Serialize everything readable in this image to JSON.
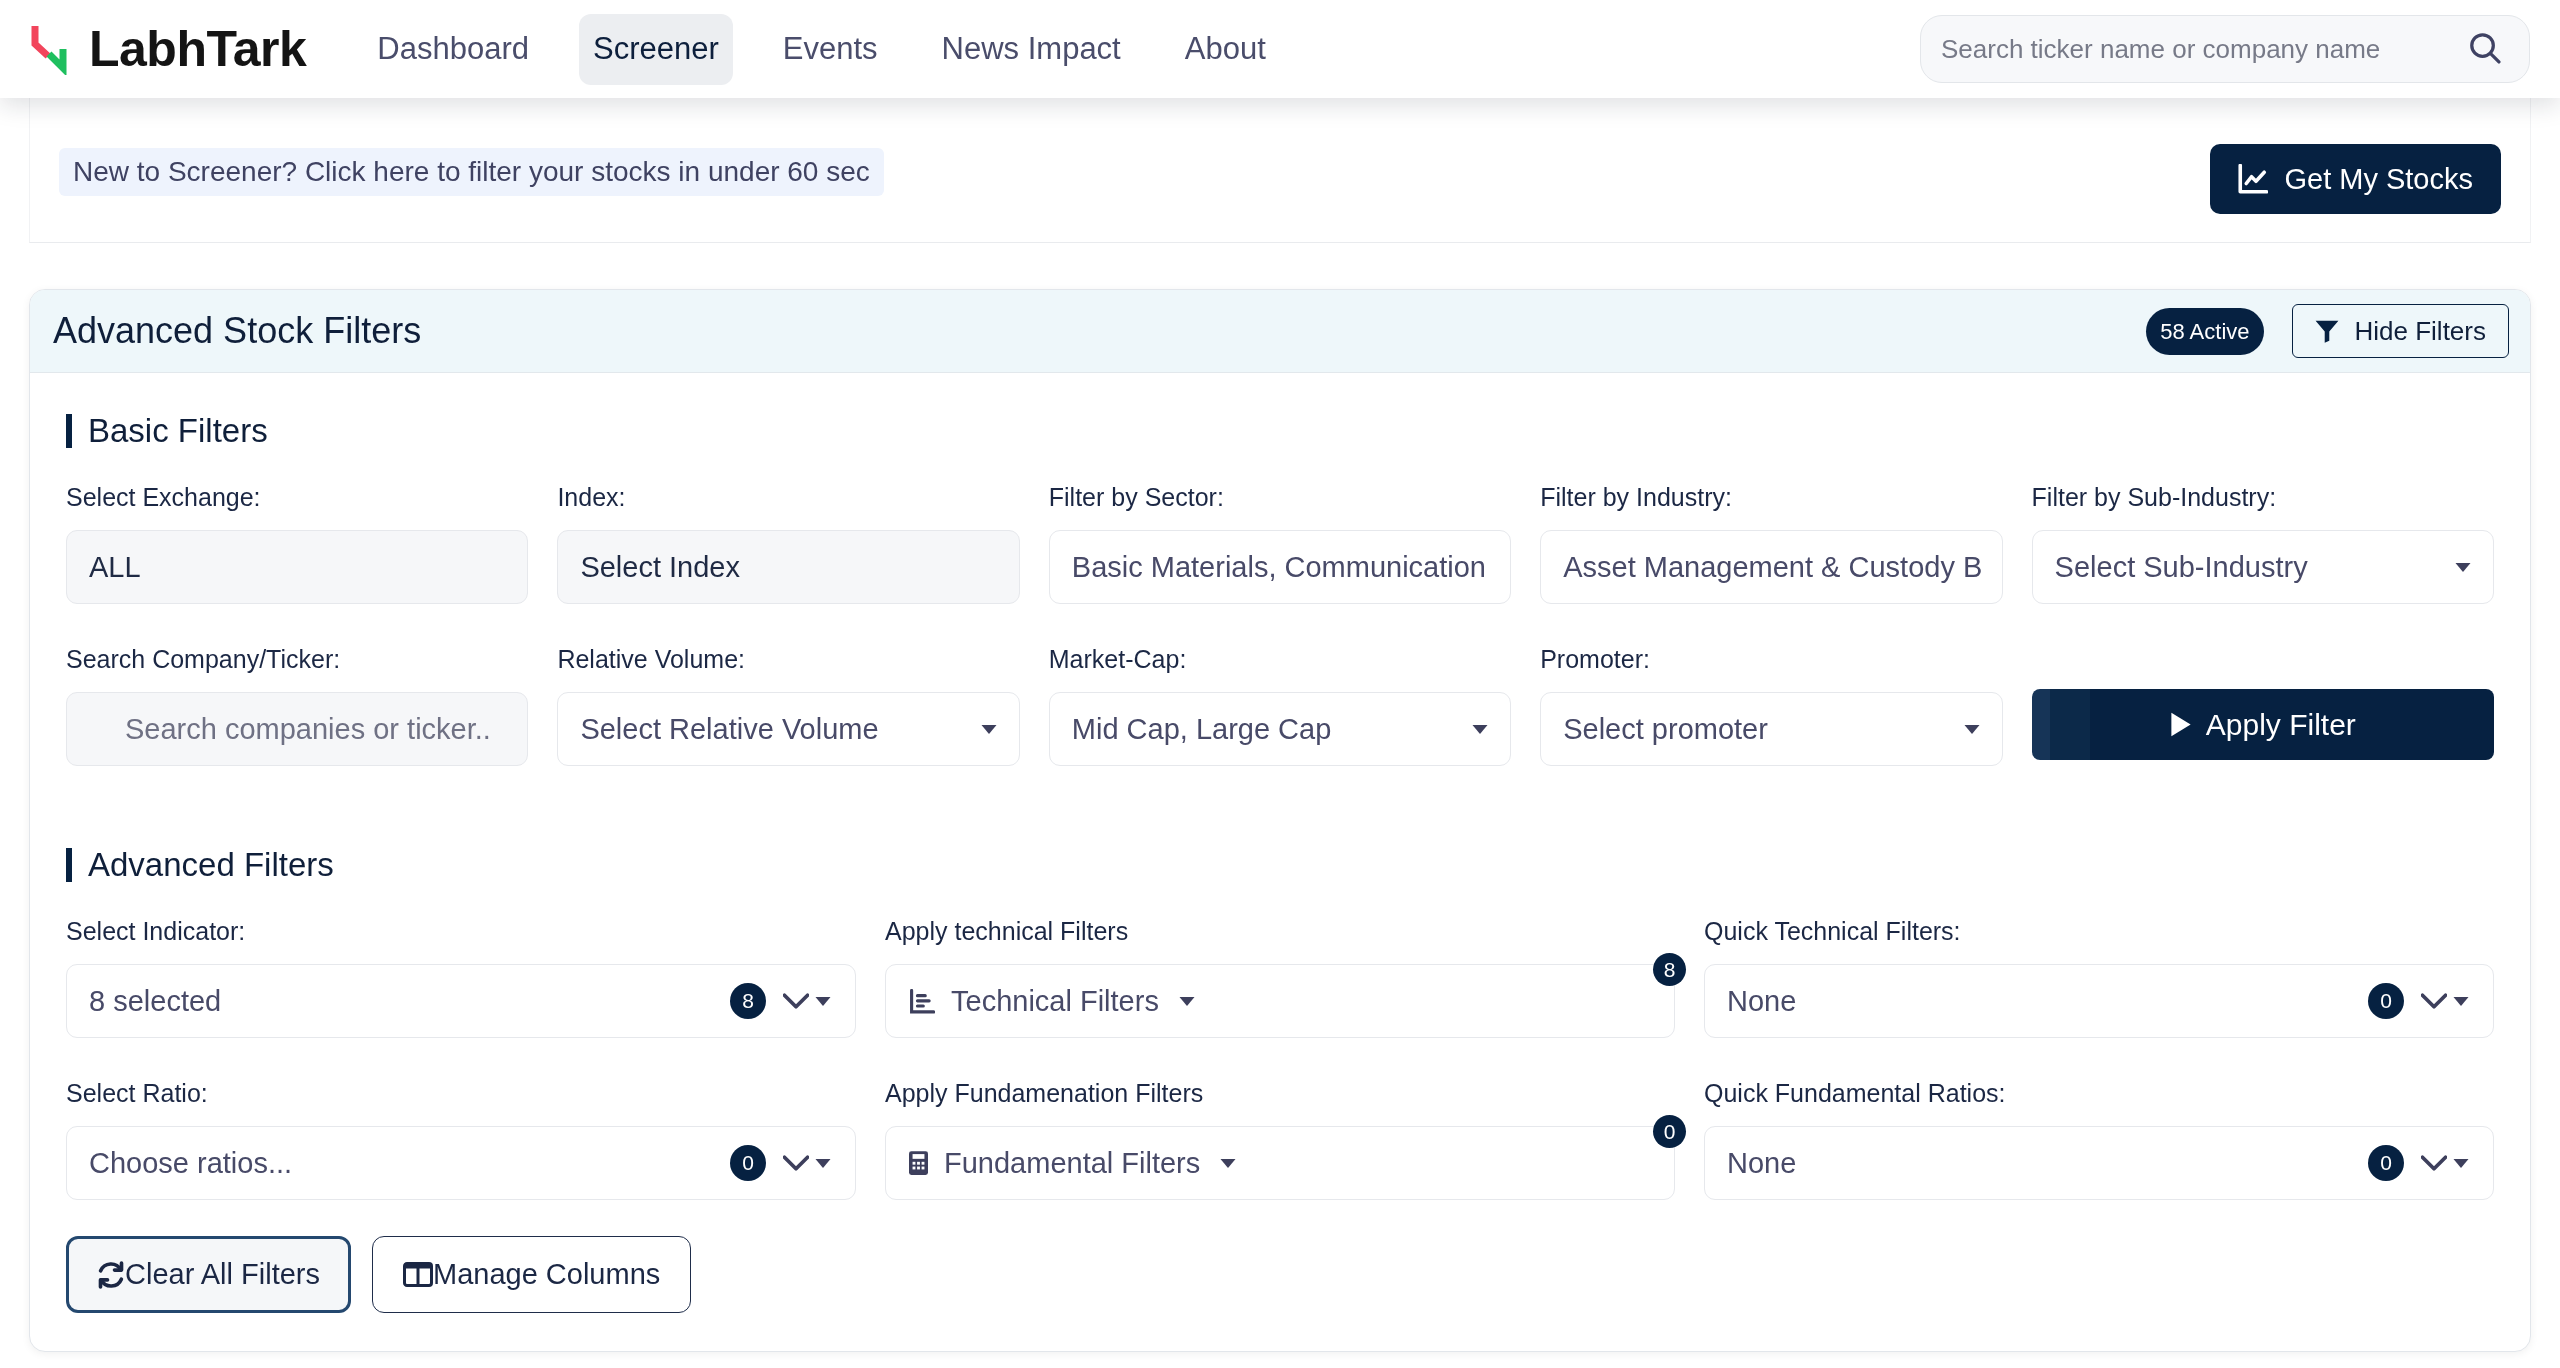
{
  "header": {
    "logo": "LabhTark",
    "nav": [
      {
        "label": "Dashboard",
        "selected": false
      },
      {
        "label": "Screener",
        "selected": true
      },
      {
        "label": "Events",
        "selected": false
      },
      {
        "label": "News Impact",
        "selected": false
      },
      {
        "label": "About",
        "selected": false
      }
    ],
    "search": {
      "placeholder": "Search ticker name or company name"
    }
  },
  "banner": {
    "prompt": "New to Screener? Click here to filter your stocks in under 60 sec",
    "button": "Get My Stocks"
  },
  "filters": {
    "title": "Advanced Stock Filters",
    "active_badge": "58 Active",
    "toggle_button": "Hide Filters",
    "basic": {
      "heading": "Basic Filters",
      "fields": [
        {
          "label": "Select Exchange:",
          "kind": "shaded",
          "value": "ALL"
        },
        {
          "label": "Index:",
          "kind": "shaded",
          "value": "Select Index"
        },
        {
          "label": "Filter by Sector:",
          "kind": "plain",
          "value": "Basic Materials, Communication"
        },
        {
          "label": "Filter by Industry:",
          "kind": "plain",
          "value": "Asset Management & Custody B"
        },
        {
          "label": "Filter by Sub-Industry:",
          "kind": "dropdown",
          "value": "Select Sub-Industry"
        },
        {
          "label": "Search Company/Ticker:",
          "kind": "search",
          "placeholder": "Search companies or ticker.."
        },
        {
          "label": "Relative Volume:",
          "kind": "dropdown",
          "value": "Select Relative Volume"
        },
        {
          "label": "Market-Cap:",
          "kind": "dropdown",
          "value": "Mid Cap, Large Cap"
        },
        {
          "label": "Promoter:",
          "kind": "dropdown",
          "value": "Select promoter"
        }
      ],
      "apply_button": "Apply Filter"
    },
    "advanced": {
      "heading": "Advanced Filters",
      "fields": [
        {
          "label": "Select Indicator:",
          "kind": "multi",
          "value": "8 selected",
          "count": "8"
        },
        {
          "label": "Apply technical Filters",
          "kind": "menu",
          "value": "Technical Filters",
          "count": "8"
        },
        {
          "label": "Quick Technical Filters:",
          "kind": "multi",
          "value": "None",
          "count": "0"
        },
        {
          "label": "Select Ratio:",
          "kind": "multi",
          "value": "Choose ratios...",
          "count": "0"
        },
        {
          "label": "Apply Fundamenation Filters",
          "kind": "menu",
          "value": "Fundamental Filters",
          "count": "0"
        },
        {
          "label": "Quick Fundamental Ratios:",
          "kind": "multi",
          "value": "None",
          "count": "0"
        }
      ]
    },
    "actions": [
      {
        "label": "Clear All Filters",
        "focused": true
      },
      {
        "label": "Manage Columns",
        "focused": false
      }
    ]
  }
}
